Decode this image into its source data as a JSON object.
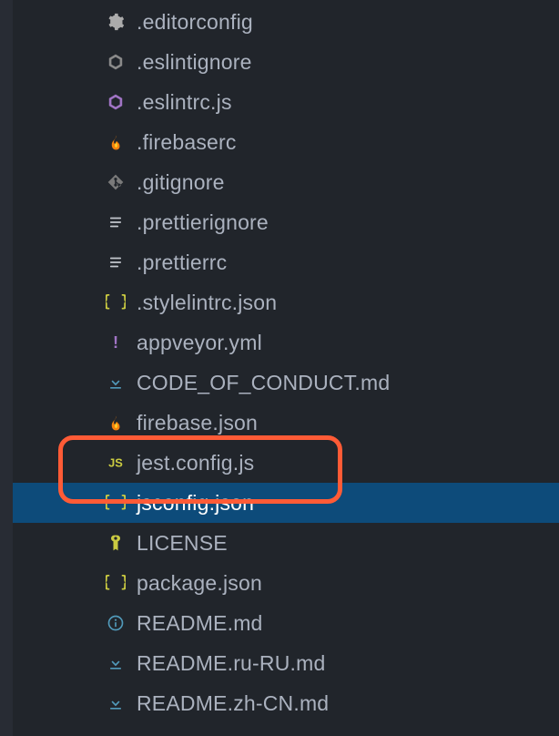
{
  "files": [
    {
      "name": ".editorconfig",
      "icon": "gear-icon",
      "color": "#ababab",
      "selected": false
    },
    {
      "name": ".eslintignore",
      "icon": "hex-icon",
      "color": "#8a8a8a",
      "selected": false
    },
    {
      "name": ".eslintrc.js",
      "icon": "hex-icon",
      "color": "#a074c4",
      "selected": false
    },
    {
      "name": ".firebaserc",
      "icon": "fire-icon",
      "color": "#f5820d",
      "selected": false
    },
    {
      "name": ".gitignore",
      "icon": "git-icon",
      "color": "#7a7a7a",
      "selected": false
    },
    {
      "name": ".prettierignore",
      "icon": "lines-icon",
      "color": "#c3c7ce",
      "selected": false
    },
    {
      "name": ".prettierrc",
      "icon": "lines-icon",
      "color": "#c3c7ce",
      "selected": false
    },
    {
      "name": ".stylelintrc.json",
      "icon": "braces-icon",
      "color": "#cbcb41",
      "selected": false
    },
    {
      "name": "appveyor.yml",
      "icon": "bang-icon",
      "color": "#a074c4",
      "selected": false
    },
    {
      "name": "CODE_OF_CONDUCT.md",
      "icon": "arrow-down-icon",
      "color": "#519aba",
      "selected": false
    },
    {
      "name": "firebase.json",
      "icon": "fire-icon",
      "color": "#f5820d",
      "selected": false
    },
    {
      "name": "jest.config.js",
      "icon": "js-icon",
      "color": "#cbcb41",
      "selected": false
    },
    {
      "name": "jsconfig.json",
      "icon": "braces-icon",
      "color": "#cbcb41",
      "selected": true
    },
    {
      "name": "LICENSE",
      "icon": "key-icon",
      "color": "#cbcb41",
      "selected": false
    },
    {
      "name": "package.json",
      "icon": "braces-icon",
      "color": "#cbcb41",
      "selected": false
    },
    {
      "name": "README.md",
      "icon": "info-icon",
      "color": "#519aba",
      "selected": false
    },
    {
      "name": "README.ru-RU.md",
      "icon": "arrow-down-icon",
      "color": "#519aba",
      "selected": false
    },
    {
      "name": "README.zh-CN.md",
      "icon": "arrow-down-icon",
      "color": "#519aba",
      "selected": false
    }
  ]
}
